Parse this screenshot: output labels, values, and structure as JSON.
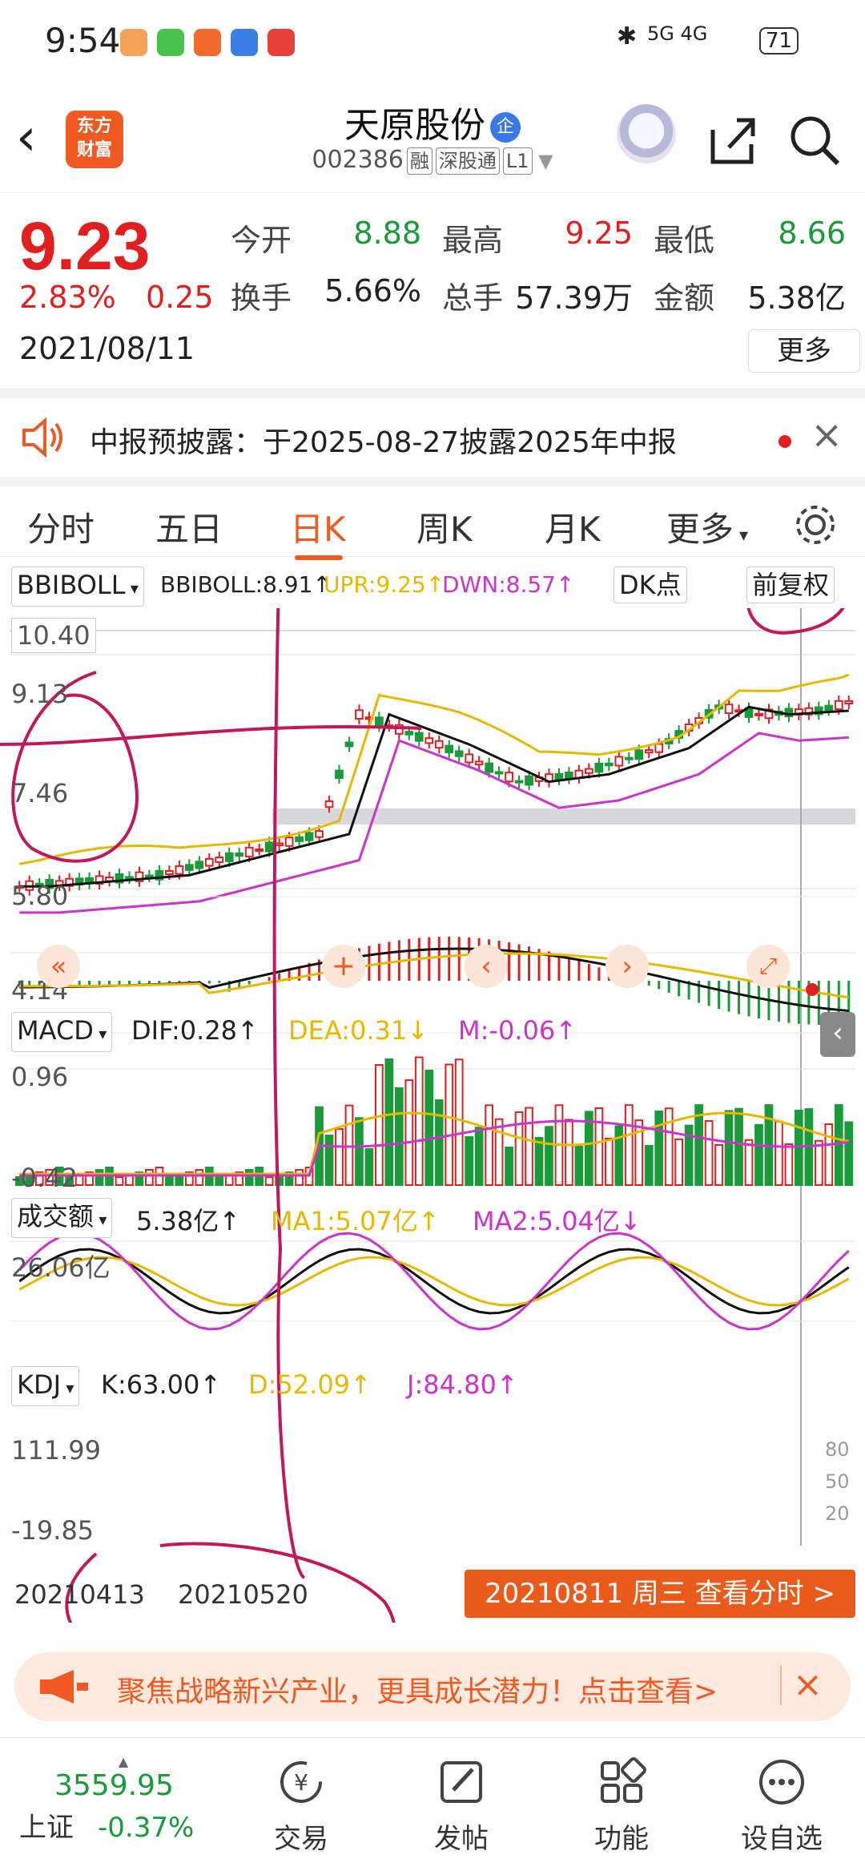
{
  "status_bar": {
    "time": "9:54",
    "network": "5G 4G",
    "battery": "71"
  },
  "header": {
    "title": "天原股份",
    "badge": "企",
    "code": "002386",
    "tags": [
      "融",
      "深股通",
      "L1"
    ]
  },
  "quote": {
    "price": "9.23",
    "change_pct": "2.83%",
    "change_amt": "0.25",
    "date": "2021/08/11",
    "fields": [
      {
        "label": "今开",
        "value": "8.88",
        "color": "#1a9a3a"
      },
      {
        "label": "最高",
        "value": "9.25",
        "color": "#e02020"
      },
      {
        "label": "最低",
        "value": "8.66",
        "color": "#1a9a3a"
      },
      {
        "label": "换手",
        "value": "5.66%",
        "color": "#222222"
      },
      {
        "label": "总手",
        "value": "57.39万",
        "color": "#222222"
      },
      {
        "label": "金额",
        "value": "5.38亿",
        "color": "#222222"
      }
    ],
    "more_label": "更多"
  },
  "notice": {
    "text": "中报预披露：于2025-08-27披露2025年中报"
  },
  "tabs": [
    "分时",
    "五日",
    "日K",
    "周K",
    "月K",
    "更多"
  ],
  "active_tab": "日K",
  "main_indicator": {
    "name": "BBIBOLL",
    "line": "BBIBOLL:8.91↑",
    "upr": "UPR:9.25↑",
    "dwn": "DWN:8.57↑",
    "dk_label": "DK点",
    "adj_label": "前复权",
    "y_ticks": [
      "10.40",
      "9.13",
      "7.46",
      "5.80",
      "4.14"
    ]
  },
  "macd": {
    "name": "MACD",
    "dif": "DIF:0.28↑",
    "dea": "DEA:0.31↓",
    "m": "M:-0.06↑",
    "y_ticks": [
      "0.96",
      "-0.42"
    ]
  },
  "volume": {
    "name": "成交额",
    "value": "5.38亿↑",
    "ma1": "MA1:5.07亿↑",
    "ma2": "MA2:5.04亿↓",
    "y_tick": "26.06亿"
  },
  "kdj": {
    "name": "KDJ",
    "k": "K:63.00↑",
    "d": "D:52.09↑",
    "j": "J:84.80↑",
    "y_ticks": [
      "111.99",
      "-19.85"
    ],
    "right_ticks": [
      "80",
      "50",
      "20"
    ]
  },
  "x_axis": {
    "dates": [
      "20210413",
      "20210520"
    ],
    "cursor_label": "20210811 周三 查看分时 >"
  },
  "banner": {
    "text": "聚焦战略新兴产业，更具成长潜力！点击查看>"
  },
  "bottom_nav": {
    "index_value": "3559.95",
    "index_name": "上证",
    "index_change": "-0.37%",
    "items": [
      "交易",
      "发帖",
      "功能",
      "设自选"
    ]
  },
  "colors": {
    "up": "#e02020",
    "down": "#1a9a3a",
    "accent": "#f05a22",
    "boll_upper": "#e8b800",
    "boll_lower": "#cc33cc"
  }
}
